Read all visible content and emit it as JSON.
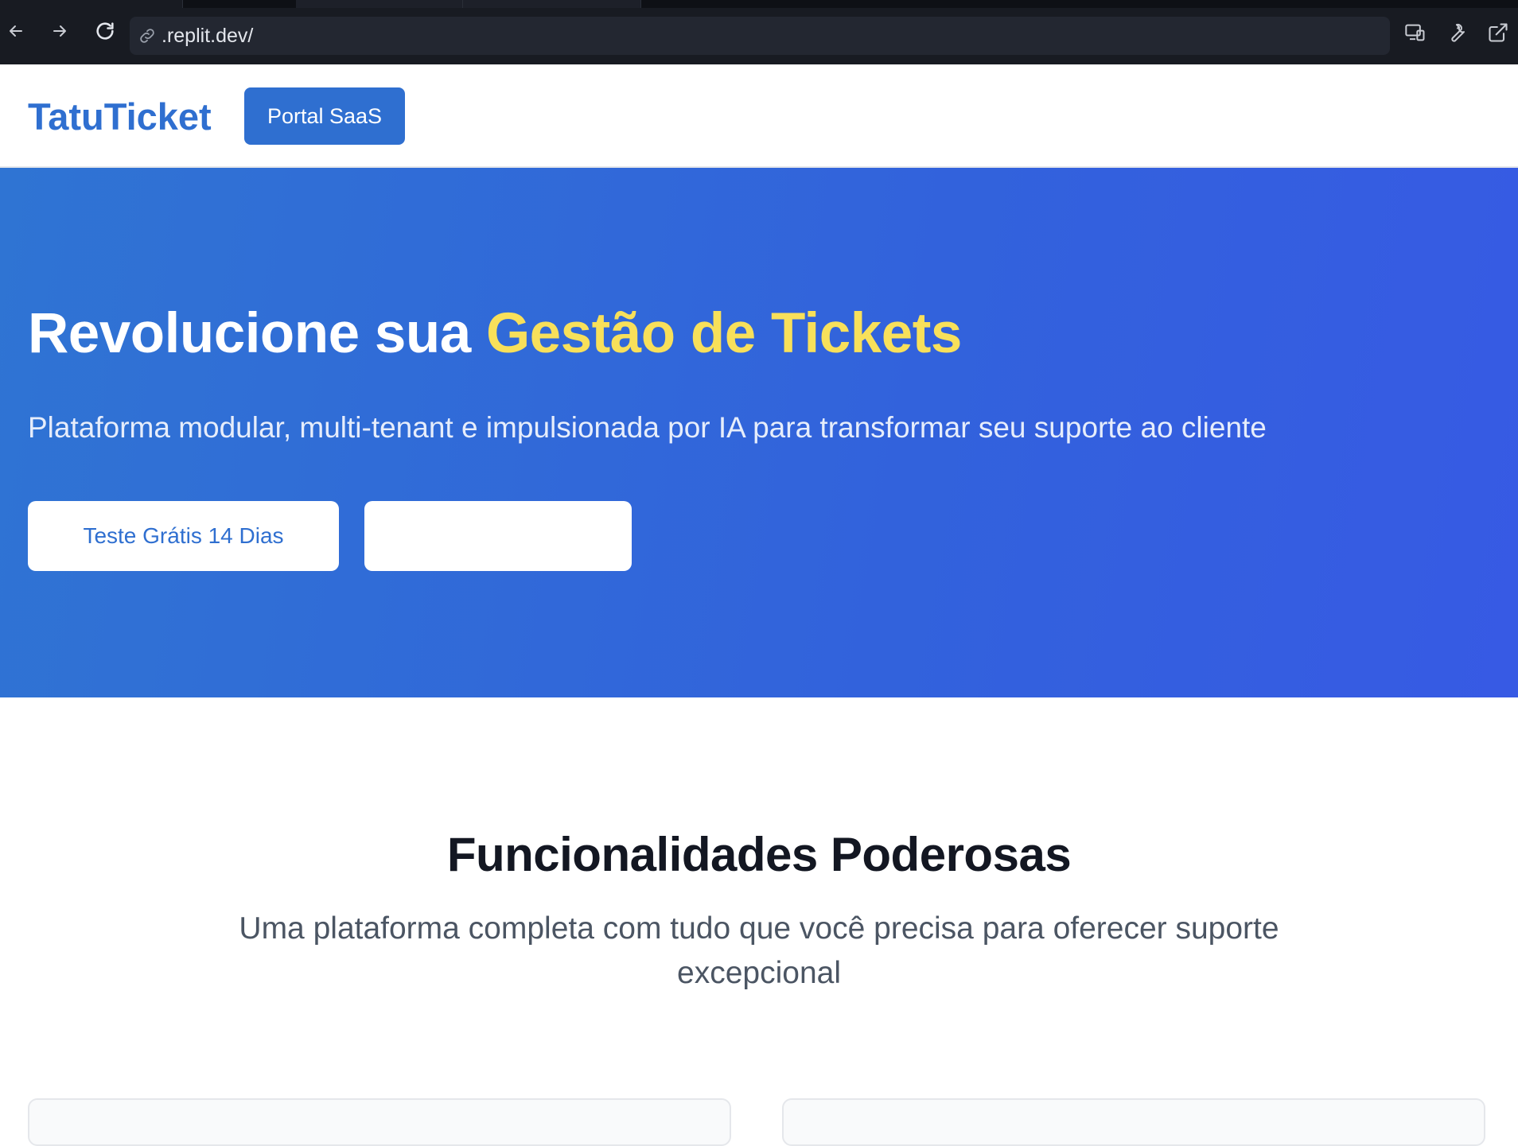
{
  "browser": {
    "url": ".replit.dev/"
  },
  "header": {
    "brand": "TatuTicket",
    "portal_button": "Portal SaaS"
  },
  "hero": {
    "title_plain": "Revolucione sua ",
    "title_accent": "Gestão de Tickets",
    "subtitle": "Plataforma modular, multi-tenant e impulsionada por IA para transformar seu suporte ao cliente",
    "cta_primary": "Teste Grátis 14 Dias",
    "cta_secondary": ""
  },
  "features": {
    "title": "Funcionalidades Poderosas",
    "subtitle": "Uma plataforma completa com tudo que você precisa para oferecer suporte excepcional"
  },
  "colors": {
    "brand_blue": "#2f6fd0",
    "accent_yellow": "#f8e05a",
    "chrome_bg": "#181b22"
  }
}
